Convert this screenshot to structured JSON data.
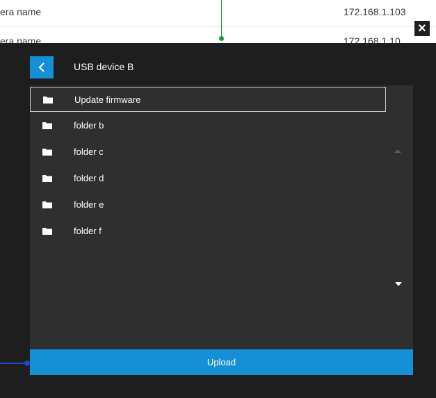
{
  "background": {
    "rows": [
      {
        "name": "era name",
        "ip": "172.168.1.103"
      },
      {
        "name": "era name",
        "ip": "172.168.1.10"
      }
    ]
  },
  "modal": {
    "close_glyph": "×",
    "back_icon": "chevron-left-icon",
    "title": "USB device B",
    "items": [
      {
        "label": "Update firmware",
        "icon": "folder-icon",
        "selected": true
      },
      {
        "label": "folder b",
        "icon": "folder-icon",
        "selected": false
      },
      {
        "label": "folder c",
        "icon": "folder-icon",
        "selected": false
      },
      {
        "label": "folder d",
        "icon": "folder-icon",
        "selected": false
      },
      {
        "label": "folder e",
        "icon": "folder-icon",
        "selected": false
      },
      {
        "label": "folder f",
        "icon": "folder-icon",
        "selected": false
      }
    ],
    "upload_label": "Upload"
  },
  "colors": {
    "accent": "#1590d6",
    "overlay": "#1e1e1e",
    "panel": "#2f2f2f",
    "connector_green": "#1a9e37",
    "connector_blue": "#1d49c9"
  }
}
